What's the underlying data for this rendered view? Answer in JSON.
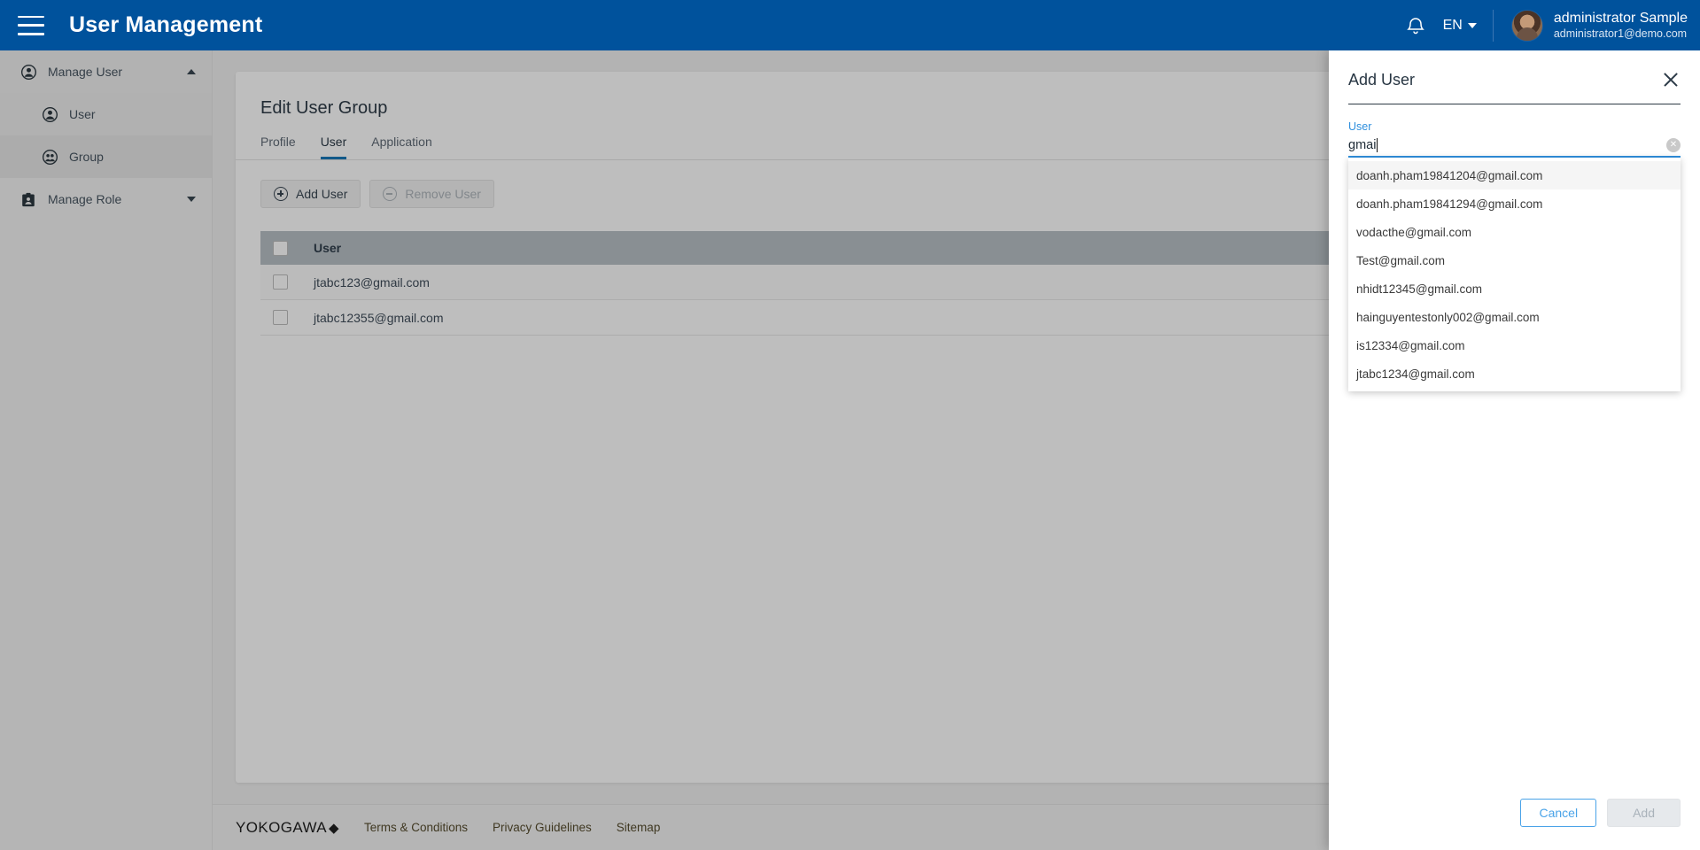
{
  "topbar": {
    "menu_icon": "hamburger-icon",
    "title": "User Management",
    "bell_icon": "bell-icon",
    "language": "EN",
    "user_name": "administrator Sample",
    "user_email": "administrator1@demo.com"
  },
  "sidebar": {
    "groups": [
      {
        "label": "Manage User",
        "icon": "person-icon",
        "expanded": true,
        "caret": "chevron-up-icon",
        "items": [
          {
            "label": "User",
            "icon": "person-circle-icon",
            "active": false
          },
          {
            "label": "Group",
            "icon": "group-icon",
            "active": true
          }
        ]
      },
      {
        "label": "Manage Role",
        "icon": "badge-icon",
        "expanded": false,
        "caret": "chevron-down-icon",
        "items": []
      }
    ]
  },
  "main": {
    "page_title": "Edit User Group",
    "tabs": [
      {
        "label": "Profile",
        "active": false
      },
      {
        "label": "User",
        "active": true
      },
      {
        "label": "Application",
        "active": false
      }
    ],
    "toolbar": {
      "add_user_label": "Add User",
      "add_user_icon": "plus-circle-icon",
      "remove_user_label": "Remove User",
      "remove_user_icon": "minus-circle-icon",
      "remove_user_disabled": true
    },
    "table": {
      "columns": [
        "User"
      ],
      "rows": [
        {
          "user": "jtabc123@gmail.com",
          "checked": false
        },
        {
          "user": "jtabc12355@gmail.com",
          "checked": false
        }
      ]
    }
  },
  "footer": {
    "brand": "YOKOGAWA",
    "brand_mark": "◆",
    "links": [
      "Terms & Conditions",
      "Privacy Guidelines",
      "Sitemap"
    ]
  },
  "drawer": {
    "title": "Add User",
    "close_icon": "close-icon",
    "field": {
      "label": "User",
      "value": "gmai",
      "placeholder": "",
      "clear_icon": "clear-circle-icon"
    },
    "suggestions": [
      {
        "label": "doanh.pham19841204@gmail.com",
        "highlighted": true
      },
      {
        "label": "doanh.pham19841294@gmail.com",
        "highlighted": false
      },
      {
        "label": "vodacthe@gmail.com",
        "highlighted": false
      },
      {
        "label": "Test@gmail.com",
        "highlighted": false
      },
      {
        "label": "nhidt12345@gmail.com",
        "highlighted": false
      },
      {
        "label": "hainguyentestonly002@gmail.com",
        "highlighted": false
      },
      {
        "label": "is12334@gmail.com",
        "highlighted": false
      },
      {
        "label": "jtabc1234@gmail.com",
        "highlighted": false
      }
    ],
    "cancel_label": "Cancel",
    "add_label": "Add",
    "add_disabled": true
  },
  "colors": {
    "brand_blue": "#00529c",
    "accent_blue": "#2f8fdd",
    "tab_active": "#0a6fb3",
    "table_header": "#b4bcc2"
  }
}
